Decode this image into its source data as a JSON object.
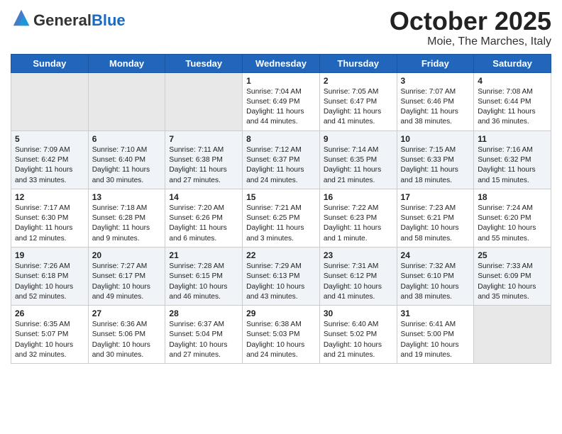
{
  "header": {
    "logo_general": "General",
    "logo_blue": "Blue",
    "month": "October 2025",
    "location": "Moie, The Marches, Italy"
  },
  "weekdays": [
    "Sunday",
    "Monday",
    "Tuesday",
    "Wednesday",
    "Thursday",
    "Friday",
    "Saturday"
  ],
  "weeks": [
    [
      {
        "day": "",
        "info": ""
      },
      {
        "day": "",
        "info": ""
      },
      {
        "day": "",
        "info": ""
      },
      {
        "day": "1",
        "info": "Sunrise: 7:04 AM\nSunset: 6:49 PM\nDaylight: 11 hours and 44 minutes."
      },
      {
        "day": "2",
        "info": "Sunrise: 7:05 AM\nSunset: 6:47 PM\nDaylight: 11 hours and 41 minutes."
      },
      {
        "day": "3",
        "info": "Sunrise: 7:07 AM\nSunset: 6:46 PM\nDaylight: 11 hours and 38 minutes."
      },
      {
        "day": "4",
        "info": "Sunrise: 7:08 AM\nSunset: 6:44 PM\nDaylight: 11 hours and 36 minutes."
      }
    ],
    [
      {
        "day": "5",
        "info": "Sunrise: 7:09 AM\nSunset: 6:42 PM\nDaylight: 11 hours and 33 minutes."
      },
      {
        "day": "6",
        "info": "Sunrise: 7:10 AM\nSunset: 6:40 PM\nDaylight: 11 hours and 30 minutes."
      },
      {
        "day": "7",
        "info": "Sunrise: 7:11 AM\nSunset: 6:38 PM\nDaylight: 11 hours and 27 minutes."
      },
      {
        "day": "8",
        "info": "Sunrise: 7:12 AM\nSunset: 6:37 PM\nDaylight: 11 hours and 24 minutes."
      },
      {
        "day": "9",
        "info": "Sunrise: 7:14 AM\nSunset: 6:35 PM\nDaylight: 11 hours and 21 minutes."
      },
      {
        "day": "10",
        "info": "Sunrise: 7:15 AM\nSunset: 6:33 PM\nDaylight: 11 hours and 18 minutes."
      },
      {
        "day": "11",
        "info": "Sunrise: 7:16 AM\nSunset: 6:32 PM\nDaylight: 11 hours and 15 minutes."
      }
    ],
    [
      {
        "day": "12",
        "info": "Sunrise: 7:17 AM\nSunset: 6:30 PM\nDaylight: 11 hours and 12 minutes."
      },
      {
        "day": "13",
        "info": "Sunrise: 7:18 AM\nSunset: 6:28 PM\nDaylight: 11 hours and 9 minutes."
      },
      {
        "day": "14",
        "info": "Sunrise: 7:20 AM\nSunset: 6:26 PM\nDaylight: 11 hours and 6 minutes."
      },
      {
        "day": "15",
        "info": "Sunrise: 7:21 AM\nSunset: 6:25 PM\nDaylight: 11 hours and 3 minutes."
      },
      {
        "day": "16",
        "info": "Sunrise: 7:22 AM\nSunset: 6:23 PM\nDaylight: 11 hours and 1 minute."
      },
      {
        "day": "17",
        "info": "Sunrise: 7:23 AM\nSunset: 6:21 PM\nDaylight: 10 hours and 58 minutes."
      },
      {
        "day": "18",
        "info": "Sunrise: 7:24 AM\nSunset: 6:20 PM\nDaylight: 10 hours and 55 minutes."
      }
    ],
    [
      {
        "day": "19",
        "info": "Sunrise: 7:26 AM\nSunset: 6:18 PM\nDaylight: 10 hours and 52 minutes."
      },
      {
        "day": "20",
        "info": "Sunrise: 7:27 AM\nSunset: 6:17 PM\nDaylight: 10 hours and 49 minutes."
      },
      {
        "day": "21",
        "info": "Sunrise: 7:28 AM\nSunset: 6:15 PM\nDaylight: 10 hours and 46 minutes."
      },
      {
        "day": "22",
        "info": "Sunrise: 7:29 AM\nSunset: 6:13 PM\nDaylight: 10 hours and 43 minutes."
      },
      {
        "day": "23",
        "info": "Sunrise: 7:31 AM\nSunset: 6:12 PM\nDaylight: 10 hours and 41 minutes."
      },
      {
        "day": "24",
        "info": "Sunrise: 7:32 AM\nSunset: 6:10 PM\nDaylight: 10 hours and 38 minutes."
      },
      {
        "day": "25",
        "info": "Sunrise: 7:33 AM\nSunset: 6:09 PM\nDaylight: 10 hours and 35 minutes."
      }
    ],
    [
      {
        "day": "26",
        "info": "Sunrise: 6:35 AM\nSunset: 5:07 PM\nDaylight: 10 hours and 32 minutes."
      },
      {
        "day": "27",
        "info": "Sunrise: 6:36 AM\nSunset: 5:06 PM\nDaylight: 10 hours and 30 minutes."
      },
      {
        "day": "28",
        "info": "Sunrise: 6:37 AM\nSunset: 5:04 PM\nDaylight: 10 hours and 27 minutes."
      },
      {
        "day": "29",
        "info": "Sunrise: 6:38 AM\nSunset: 5:03 PM\nDaylight: 10 hours and 24 minutes."
      },
      {
        "day": "30",
        "info": "Sunrise: 6:40 AM\nSunset: 5:02 PM\nDaylight: 10 hours and 21 minutes."
      },
      {
        "day": "31",
        "info": "Sunrise: 6:41 AM\nSunset: 5:00 PM\nDaylight: 10 hours and 19 minutes."
      },
      {
        "day": "",
        "info": ""
      }
    ]
  ]
}
